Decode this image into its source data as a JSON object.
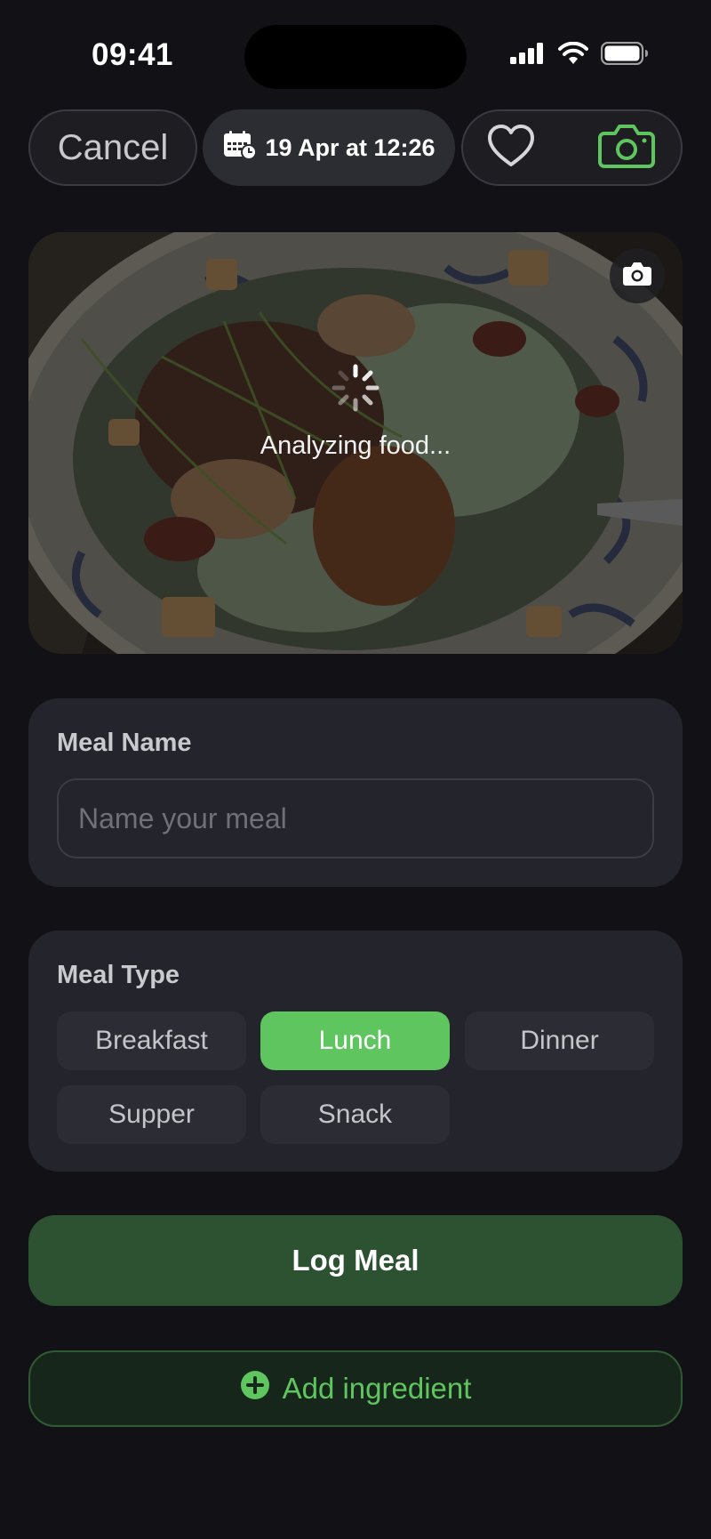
{
  "status_bar": {
    "time": "09:41",
    "icons": [
      "signal-icon",
      "wifi-icon",
      "battery-icon"
    ]
  },
  "top_bar": {
    "cancel_label": "Cancel",
    "date_label": "19 Apr at 12:26",
    "icons": [
      "calendar-clock-icon",
      "heart-icon",
      "camera-icon"
    ]
  },
  "photo": {
    "status_text": "Analyzing food...",
    "icons": [
      "camera-icon",
      "spinner-icon"
    ]
  },
  "meal_name": {
    "title": "Meal Name",
    "placeholder": "Name your meal",
    "value": ""
  },
  "meal_type": {
    "title": "Meal Type",
    "options": [
      "Breakfast",
      "Lunch",
      "Dinner",
      "Supper",
      "Snack"
    ],
    "selected": "Lunch"
  },
  "actions": {
    "log_label": "Log Meal",
    "add_label": "Add ingredient"
  },
  "colors": {
    "accent": "#5fc55f",
    "background": "#121216",
    "card": "#24242c",
    "log_button": "#2c5232"
  }
}
